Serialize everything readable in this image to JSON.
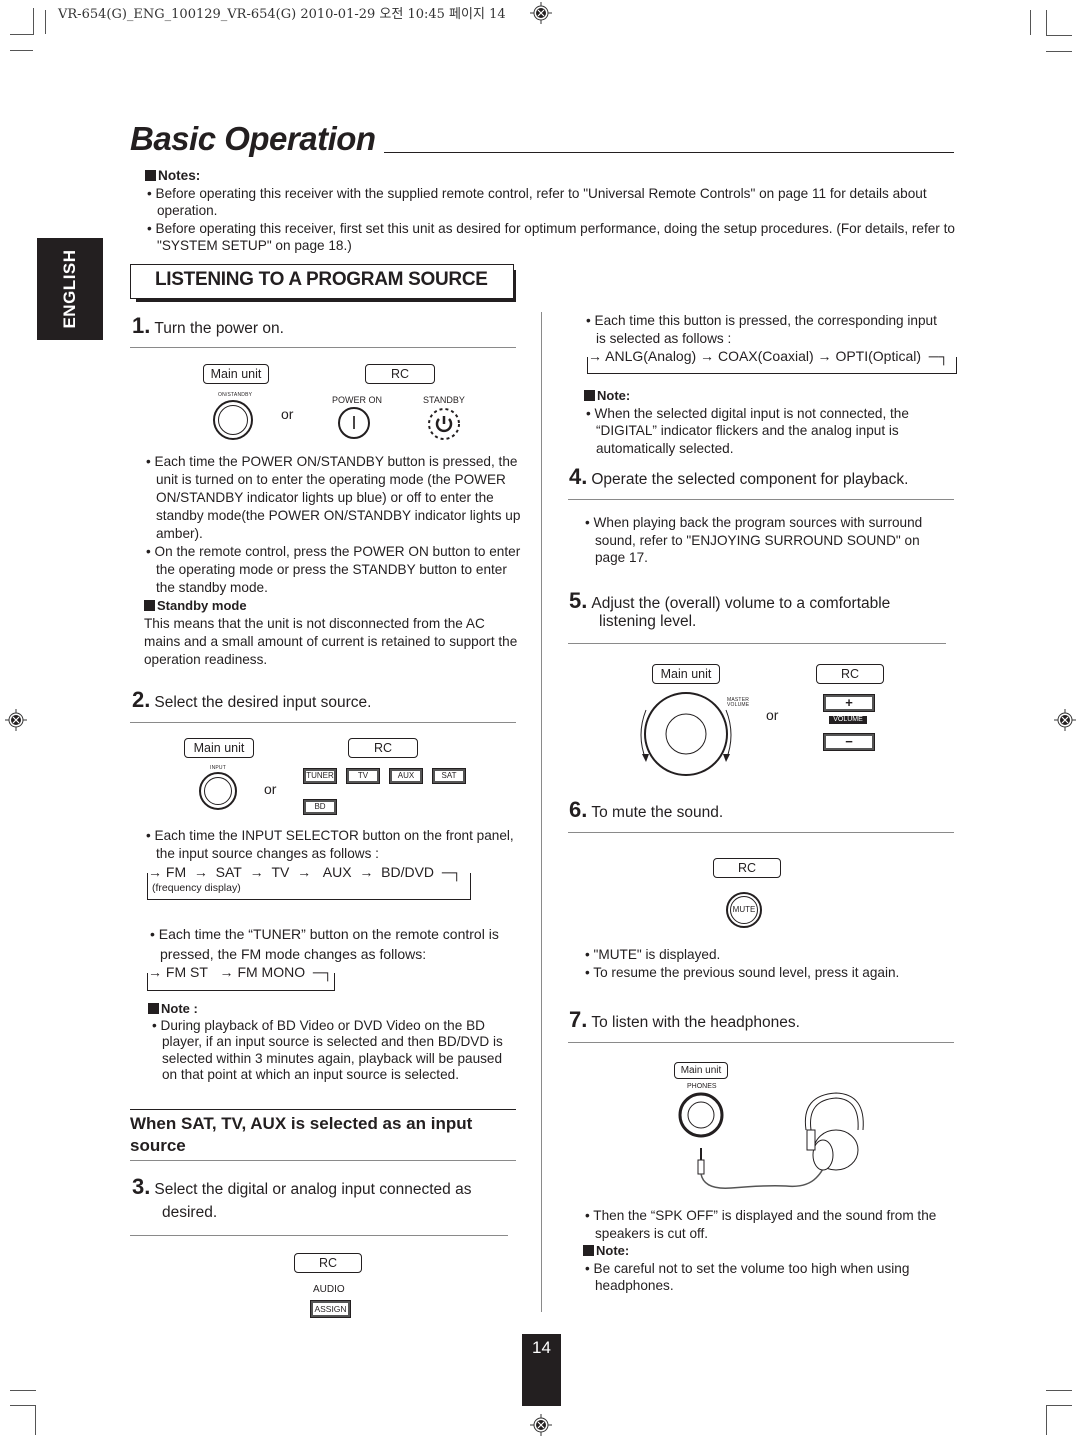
{
  "print_header": "VR-654(G)_ENG_100129_VR-654(G)  2010-01-29  오전 10:45  페이지 14",
  "page_title": "Basic Operation",
  "language_tab": "ENGLISH",
  "notes": {
    "heading": "Notes:",
    "items": [
      "Before operating this receiver with the supplied remote control, refer to \"Universal Remote Controls\" on page 11 for details about operation.",
      "Before operating this receiver, first set this unit as desired for optimum performance, doing the setup procedures. (For details, refer to \"SYSTEM SETUP\" on page 18.)"
    ]
  },
  "section_title": "LISTENING TO A PROGRAM SOURCE",
  "steps": {
    "s1": {
      "num": "1.",
      "text": "Turn the power on.",
      "labels": {
        "main_unit": "Main unit",
        "rc": "RC",
        "on_standby": "ON/STANDBY",
        "power_on": "POWER ON",
        "standby": "STANDBY",
        "or": "or",
        "power_on_glyph": "I"
      },
      "bullets": [
        "Each time the POWER ON/STANDBY button is pressed, the unit is turned on to enter the operating mode (the POWER ON/STANDBY indicator lights up blue) or off to enter the standby mode(the POWER ON/STANDBY indicator lights up amber).",
        "On the remote control, press the POWER ON button to enter the operating mode or press the STANDBY button to enter the standby mode."
      ],
      "standby_heading": "Standby mode",
      "standby_text": "This means that the unit is not disconnected from the AC mains and a small amount of current is retained to support the operation readiness."
    },
    "s2": {
      "num": "2.",
      "text": "Select the desired input source.",
      "labels": {
        "main_unit": "Main unit",
        "rc": "RC",
        "input": "INPUT",
        "or": "or"
      },
      "rc_buttons": [
        "TUNER",
        "TV",
        "AUX",
        "SAT",
        "BD"
      ],
      "bullet1": "Each time the INPUT SELECTOR button on the front panel, the input source changes as follows :",
      "input_cycle": [
        "FM",
        "SAT",
        "TV",
        "AUX",
        "BD/DVD"
      ],
      "freq_note": "(frequency display)",
      "bullet2": "Each time the “TUNER” button on the remote control is pressed, the FM mode changes as follows:",
      "fm_cycle": [
        "FM ST",
        "FM MONO"
      ],
      "note_heading": "Note :",
      "note_text": "During playback of BD Video or DVD Video on the BD player, if an input source is selected and then BD/DVD is selected within 3 minutes again, playback will be paused on that point at which an input source is selected."
    },
    "subsection_title": "When SAT, TV, AUX is selected as an input source",
    "s3": {
      "num": "3.",
      "text_line1": "Select the digital or analog input connected as",
      "text_line2": "desired.",
      "labels": {
        "rc": "RC",
        "audio": "AUDIO",
        "assign": "ASSIGN"
      },
      "bullet": "Each time this button is pressed, the corresponding input is selected as follows :",
      "cycle": [
        "ANLG(Analog)",
        "COAX(Coaxial)",
        "OPTI(Optical)"
      ],
      "note_heading": "Note:",
      "note_text": "When the selected digital input is not connected, the “DIGITAL” indicator flickers and the analog input is automatically selected."
    },
    "s4": {
      "num": "4.",
      "text": "Operate the selected component for playback.",
      "bullet": "When playing back the program sources with surround sound, refer to \"ENJOYING SURROUND SOUND\" on page 17."
    },
    "s5": {
      "num": "5.",
      "text_line1": "Adjust the (overall) volume to a comfortable",
      "text_line2": "listening level.",
      "labels": {
        "main_unit": "Main unit",
        "rc": "RC",
        "master_volume": "MASTER VOLUME",
        "or": "or",
        "plus": "+",
        "volume": "VOLUME",
        "minus": "−"
      }
    },
    "s6": {
      "num": "6.",
      "text": "To mute the sound.",
      "labels": {
        "rc": "RC",
        "mute": "MUTE"
      },
      "bullets": [
        "\"MUTE\" is displayed.",
        "To resume the previous sound level, press it again."
      ]
    },
    "s7": {
      "num": "7.",
      "text": "To listen with the headphones.",
      "labels": {
        "main_unit": "Main unit",
        "phones": "PHONES"
      },
      "bullet": "Then the “SPK OFF” is displayed and the sound from the speakers is cut off.",
      "note_heading": "Note:",
      "note_text": "Be careful not to set the volume too high when using headphones."
    }
  },
  "page_number": "14"
}
